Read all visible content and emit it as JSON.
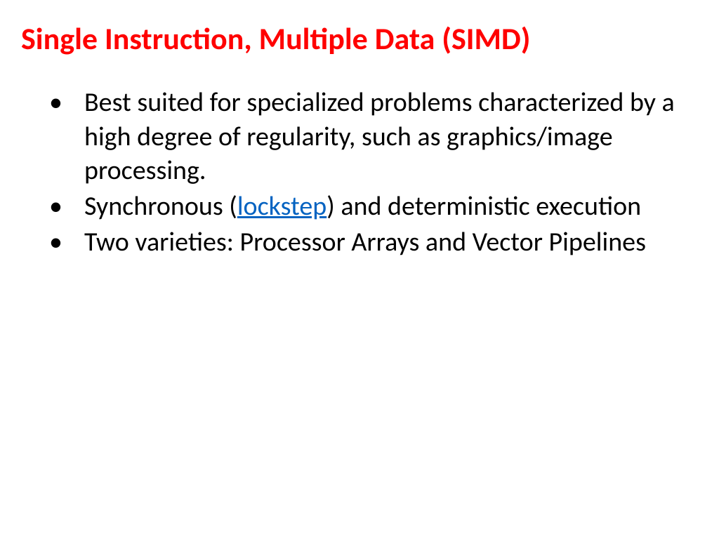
{
  "title": "Single Instruction, Multiple Data (SIMD)",
  "bullets": [
    {
      "text": "Best suited for specialized problems characterized by a high degree of regularity, such as graphics/image processing."
    },
    {
      "prefix": "Synchronous (",
      "link": "lockstep",
      "suffix": ") and deterministic execution"
    },
    {
      "text": "Two varieties: Processor Arrays and Vector Pipelines"
    }
  ]
}
